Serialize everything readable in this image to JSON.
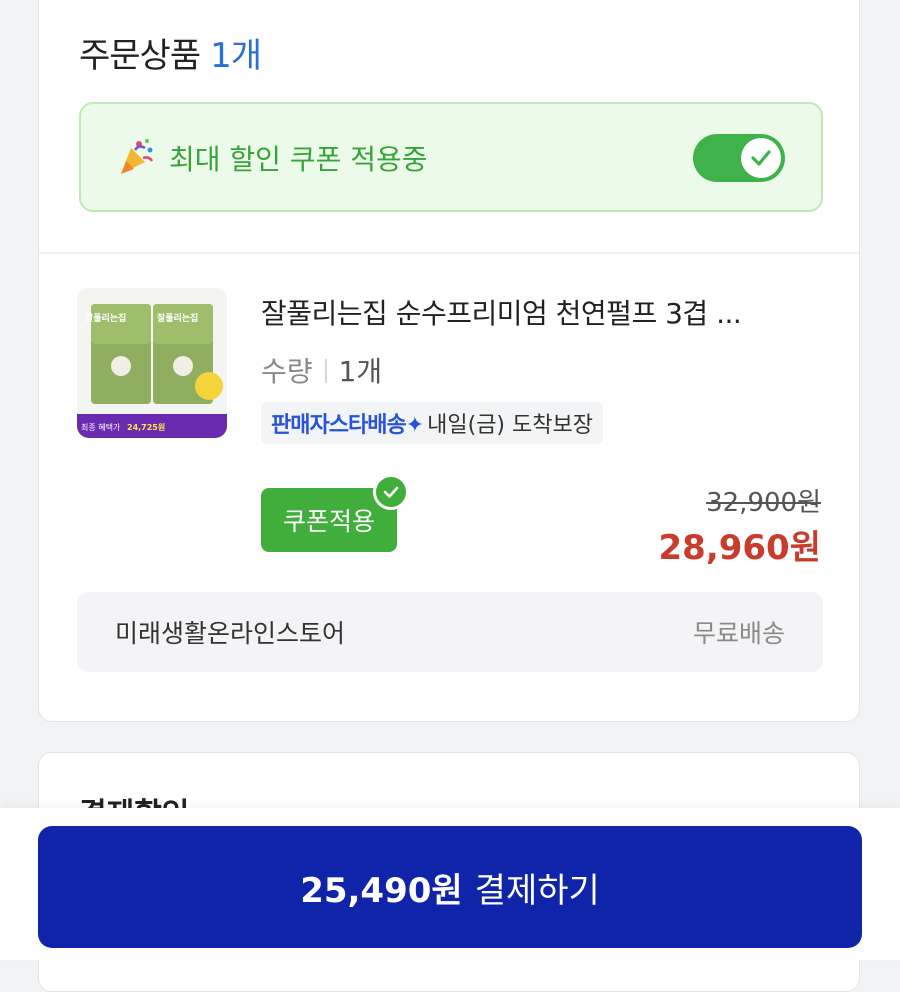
{
  "order_section": {
    "title": "주문상품",
    "count": "1개"
  },
  "coupon_banner": {
    "label": "최대 할인 쿠폰 적용중",
    "toggle_on": true,
    "colors": {
      "background": "#ecfbe9",
      "accent": "#3fb24a"
    }
  },
  "product": {
    "name": "잘풀리는집 순수프리미엄 천연펄프 3겹 ...",
    "quantity_label": "수량",
    "quantity_value": "1개",
    "delivery_badge": "판매자스타배송✦",
    "delivery_text": "내일(금) 도착보장",
    "coupon_button": "쿠폰적용",
    "original_price": "32,900원",
    "sale_price": "28,960원",
    "thumbnail_text": {
      "brand": "잘풀리는집",
      "final_price_label": "최종 혜택가",
      "final_price_value": "24,725원"
    }
  },
  "store": {
    "name": "미래생활온라인스토어",
    "shipping": "무료배송"
  },
  "next_section": {
    "title": "결제할인"
  },
  "pay_button": {
    "amount": "25,490원",
    "label": "결제하기",
    "color": "#0f24a8"
  }
}
